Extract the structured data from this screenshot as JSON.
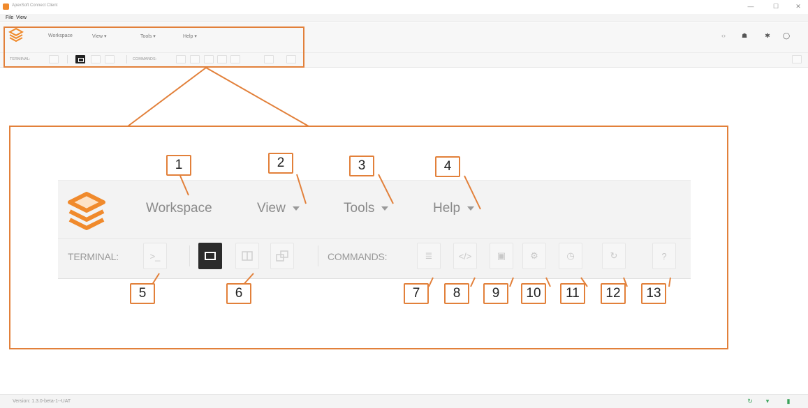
{
  "window": {
    "title": "ApexSoft Connect Client",
    "minimize_icon": "—",
    "maximize_icon": "☐",
    "close_icon": "✕"
  },
  "menubar": {
    "file": "File",
    "view": "View"
  },
  "small_toolbar": {
    "menus": [
      "Workspace",
      "View ▾",
      "Tools ▾",
      "Help ▾"
    ],
    "terminal_label": "TERMINAL:",
    "commands_label": "COMMANDS:",
    "right_icons": [
      "code-icon",
      "team-icon",
      "gear-icon",
      "user-icon"
    ],
    "right_glyphs": [
      "‹›",
      "☗",
      "✱",
      "◯"
    ]
  },
  "zoom": {
    "menus": [
      {
        "label": "Workspace",
        "has_caret": false
      },
      {
        "label": "View",
        "has_caret": true
      },
      {
        "label": "Tools",
        "has_caret": true
      },
      {
        "label": "Help",
        "has_caret": true
      }
    ],
    "terminal_label": "TERMINAL:",
    "commands_label": "COMMANDS:",
    "terminal_button_glyph": ">_",
    "command_glyphs": [
      "≣",
      "</>",
      "▣",
      "⚙",
      "◷",
      "↻",
      "?"
    ]
  },
  "badges": [
    "1",
    "2",
    "3",
    "4",
    "5",
    "6",
    "7",
    "8",
    "9",
    "10",
    "11",
    "12",
    "13"
  ],
  "statusbar": {
    "version": "Version: 1.3.0-beta-1--UAT",
    "icons": [
      "refresh-icon",
      "wifi-icon",
      "database-icon"
    ],
    "glyphs": [
      "↻",
      "▾",
      "▮"
    ]
  },
  "colors": {
    "accent": "#e2803a",
    "logo": "#f08a2c"
  }
}
